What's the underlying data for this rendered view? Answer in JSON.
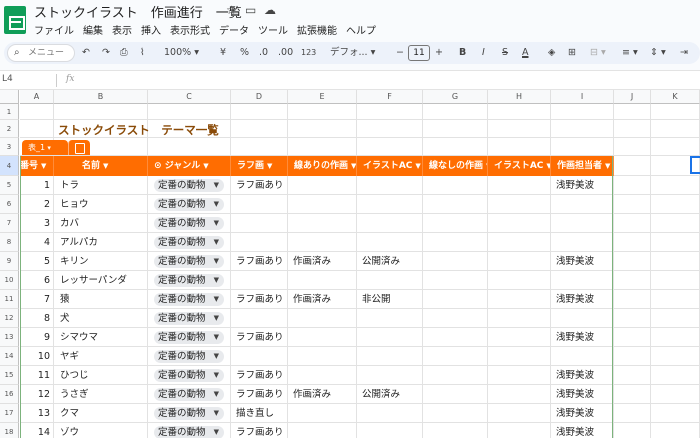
{
  "app": {
    "title": "ストックイラスト　作画進行　一覧",
    "menu": [
      "ファイル",
      "編集",
      "表示",
      "挿入",
      "表示形式",
      "データ",
      "ツール",
      "拡張機能",
      "ヘルプ"
    ]
  },
  "toolbar": {
    "search_placeholder": "メニュー",
    "zoom": "100%",
    "currency": "¥",
    "percent": "%",
    "dec_less": ".0",
    "dec_more": ".00",
    "num_format": "123",
    "font": "デフォ...",
    "font_size": "11",
    "minus": "−",
    "plus": "+",
    "bold": "B",
    "italic": "I",
    "strike": "S",
    "textcolor": "A"
  },
  "formula_bar": {
    "name_box": "L4",
    "fx": "fx"
  },
  "columns": [
    "A",
    "B",
    "C",
    "D",
    "E",
    "F",
    "G",
    "H",
    "I",
    "J",
    "K"
  ],
  "sheet_title": "ストックイラスト　テーマ一覧",
  "table_name": "表_1",
  "table_headers": [
    "番号",
    "名前",
    "ジャンル",
    "ラフ画",
    "線ありの作画",
    "イラストAC",
    "線なしの作画",
    "イラストAC",
    "作画担当者"
  ],
  "rows": [
    {
      "no": "1",
      "name": "トラ",
      "genre": "定番の動物",
      "rough": "ラフ画あり",
      "lined": "",
      "ac1": "",
      "nolined": "",
      "ac2": "",
      "artist": "浅野美波"
    },
    {
      "no": "2",
      "name": "ヒョウ",
      "genre": "定番の動物",
      "rough": "",
      "lined": "",
      "ac1": "",
      "nolined": "",
      "ac2": "",
      "artist": ""
    },
    {
      "no": "3",
      "name": "カバ",
      "genre": "定番の動物",
      "rough": "",
      "lined": "",
      "ac1": "",
      "nolined": "",
      "ac2": "",
      "artist": ""
    },
    {
      "no": "4",
      "name": "アルパカ",
      "genre": "定番の動物",
      "rough": "",
      "lined": "",
      "ac1": "",
      "nolined": "",
      "ac2": "",
      "artist": ""
    },
    {
      "no": "5",
      "name": "キリン",
      "genre": "定番の動物",
      "rough": "ラフ画あり",
      "lined": "作画済み",
      "ac1": "公開済み",
      "nolined": "",
      "ac2": "",
      "artist": "浅野美波"
    },
    {
      "no": "6",
      "name": "レッサーパンダ",
      "genre": "定番の動物",
      "rough": "",
      "lined": "",
      "ac1": "",
      "nolined": "",
      "ac2": "",
      "artist": ""
    },
    {
      "no": "7",
      "name": "猿",
      "genre": "定番の動物",
      "rough": "ラフ画あり",
      "lined": "作画済み",
      "ac1": "非公開",
      "nolined": "",
      "ac2": "",
      "artist": "浅野美波"
    },
    {
      "no": "8",
      "name": "犬",
      "genre": "定番の動物",
      "rough": "",
      "lined": "",
      "ac1": "",
      "nolined": "",
      "ac2": "",
      "artist": ""
    },
    {
      "no": "9",
      "name": "シマウマ",
      "genre": "定番の動物",
      "rough": "ラフ画あり",
      "lined": "",
      "ac1": "",
      "nolined": "",
      "ac2": "",
      "artist": "浅野美波"
    },
    {
      "no": "10",
      "name": "ヤギ",
      "genre": "定番の動物",
      "rough": "",
      "lined": "",
      "ac1": "",
      "nolined": "",
      "ac2": "",
      "artist": ""
    },
    {
      "no": "11",
      "name": "ひつじ",
      "genre": "定番の動物",
      "rough": "ラフ画あり",
      "lined": "",
      "ac1": "",
      "nolined": "",
      "ac2": "",
      "artist": "浅野美波"
    },
    {
      "no": "12",
      "name": "うさぎ",
      "genre": "定番の動物",
      "rough": "ラフ画あり",
      "lined": "作画済み",
      "ac1": "公開済み",
      "nolined": "",
      "ac2": "",
      "artist": "浅野美波"
    },
    {
      "no": "13",
      "name": "クマ",
      "genre": "定番の動物",
      "rough": "描き直し",
      "lined": "",
      "ac1": "",
      "nolined": "",
      "ac2": "",
      "artist": "浅野美波"
    },
    {
      "no": "14",
      "name": "ゾウ",
      "genre": "定番の動物",
      "rough": "ラフ画あり",
      "lined": "",
      "ac1": "",
      "nolined": "",
      "ac2": "",
      "artist": "浅野美波"
    }
  ],
  "row_numbers": [
    "1",
    "2",
    "3",
    "4",
    "5",
    "6",
    "7",
    "8",
    "9",
    "10",
    "11",
    "12",
    "13",
    "14",
    "15",
    "16",
    "17",
    "18"
  ]
}
